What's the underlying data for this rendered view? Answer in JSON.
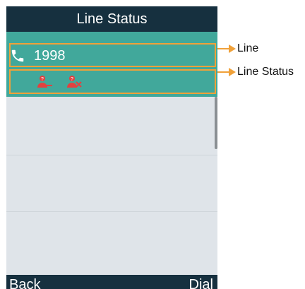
{
  "header": {
    "title": "Line Status"
  },
  "line": {
    "number": "1998",
    "icon": "phone-icon"
  },
  "line_status": {
    "icons": [
      "unregistered-user-icon",
      "failed-registration-user-icon"
    ]
  },
  "softkeys": {
    "left": "Back",
    "right": "Dial"
  },
  "annotations": {
    "line": "Line",
    "line_status": "Line Status"
  },
  "colors": {
    "title_bar": "#16303f",
    "selected_row": "#41a89b",
    "list_bg": "#dfe4e9",
    "highlight_box": "#f0a139",
    "status_icon": "#e2413f"
  }
}
